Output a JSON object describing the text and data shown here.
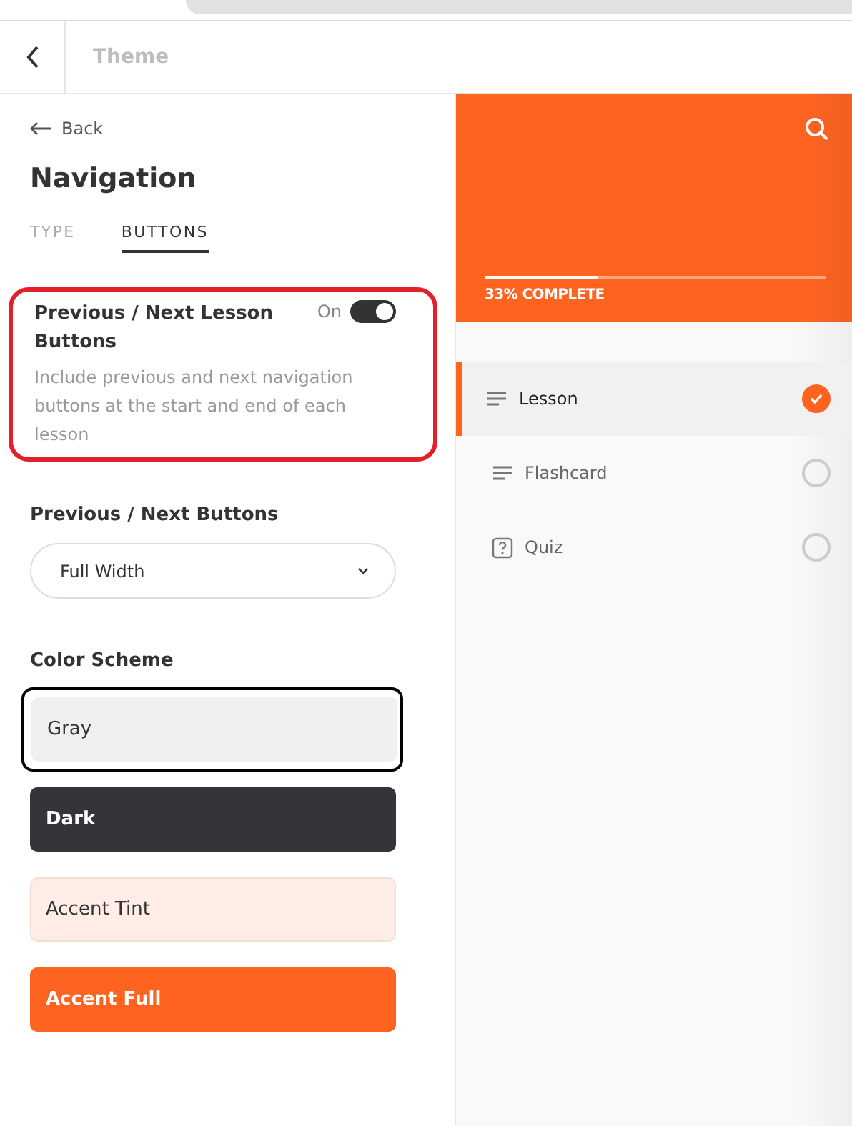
{
  "header": {
    "title": "Theme"
  },
  "panel": {
    "back": "Back",
    "heading": "Navigation",
    "tabs": [
      {
        "label": "TYPE",
        "selected": false
      },
      {
        "label": "BUTTONS",
        "selected": true
      }
    ],
    "setting": {
      "label": "Previous / Next Lesson Buttons",
      "state_label": "On",
      "on": true,
      "highlighted": true,
      "description": "Include previous and next navigation buttons at the start and end of each lesson"
    },
    "select": {
      "label": "Previous / Next Buttons",
      "value": "Full Width"
    },
    "color_scheme": {
      "label": "Color Scheme",
      "options": [
        {
          "label": "Gray",
          "kind": "gray",
          "selected": true
        },
        {
          "label": "Dark",
          "kind": "dark",
          "selected": false
        },
        {
          "label": "Accent Tint",
          "kind": "tint",
          "selected": false
        },
        {
          "label": "Accent Full",
          "kind": "full",
          "selected": false
        }
      ]
    }
  },
  "preview": {
    "progress": {
      "level": 0.33,
      "label": "33% COMPLETE"
    },
    "lessons": [
      {
        "label": "Lesson",
        "kind": "text",
        "selected": true,
        "completed": true
      },
      {
        "label": "Flashcard",
        "kind": "text",
        "selected": false,
        "completed": false
      },
      {
        "label": "Quiz",
        "kind": "quiz",
        "selected": false,
        "completed": false
      }
    ]
  }
}
